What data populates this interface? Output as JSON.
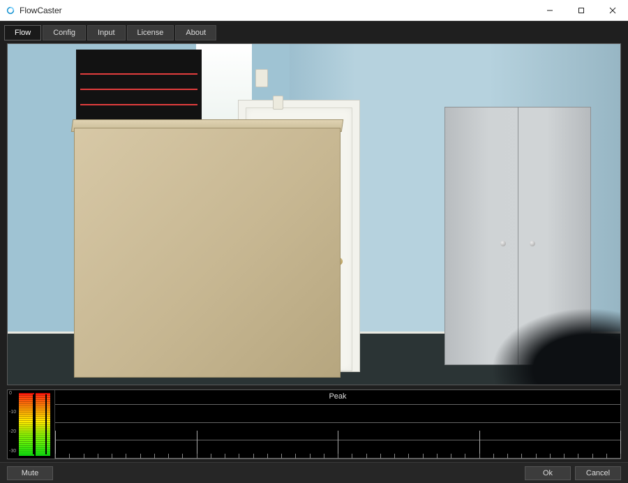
{
  "window": {
    "title": "FlowCaster"
  },
  "tabs": [
    {
      "id": "flow",
      "label": "Flow",
      "active": true
    },
    {
      "id": "config",
      "label": "Config",
      "active": false
    },
    {
      "id": "input",
      "label": "Input",
      "active": false
    },
    {
      "id": "license",
      "label": "License",
      "active": false
    },
    {
      "id": "about",
      "label": "About",
      "active": false
    }
  ],
  "meter": {
    "peak_label": "Peak",
    "scale_labels": [
      "0",
      "-10",
      "-20",
      "-30"
    ]
  },
  "buttons": {
    "mute": "Mute",
    "ok": "Ok",
    "cancel": "Cancel"
  }
}
